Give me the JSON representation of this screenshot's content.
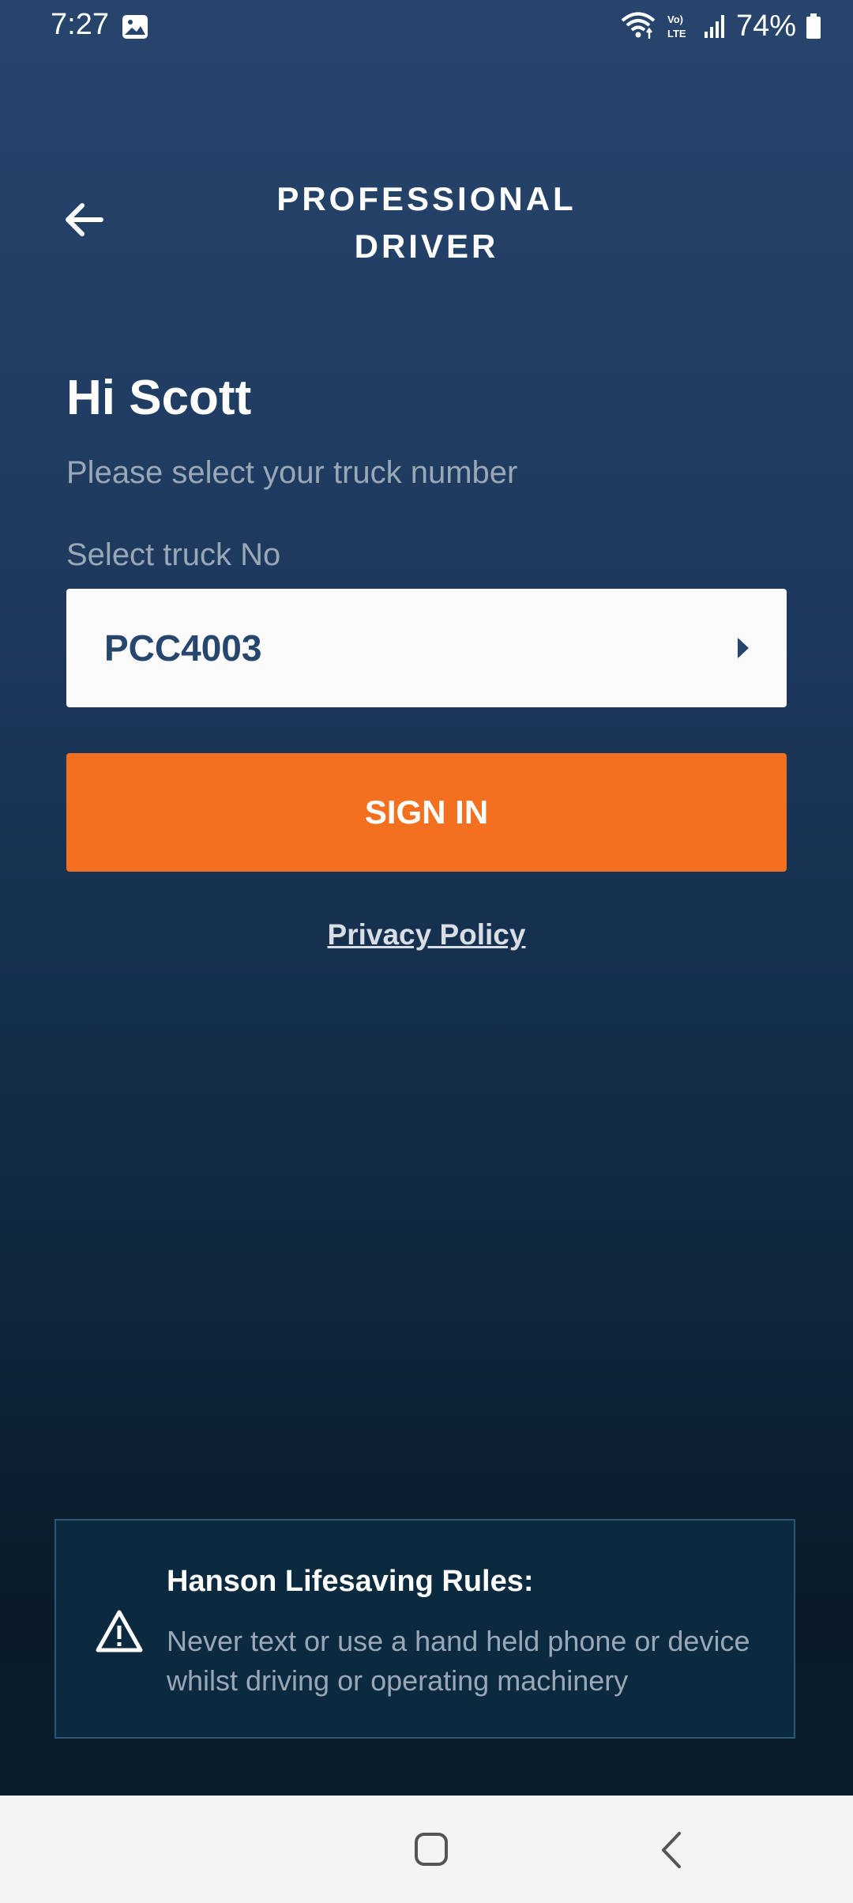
{
  "status_bar": {
    "time": "7:27",
    "battery_percent": "74%",
    "icons": [
      "gallery-icon",
      "wifi-icon",
      "volte-icon",
      "signal-icon",
      "battery-icon"
    ]
  },
  "header": {
    "title_line1": "PROFESSIONAL",
    "title_line2": "DRIVER",
    "back_icon": "arrow-left-icon"
  },
  "main": {
    "greeting": "Hi Scott",
    "subtitle": "Please select your truck number",
    "select_label": "Select truck No",
    "selected_truck": "PCC4003",
    "sign_in_label": "SIGN IN",
    "privacy_label": "Privacy Policy"
  },
  "rules": {
    "title": "Hanson Lifesaving Rules:",
    "text": "Never text or use a hand held phone or device whilst driving or operating machinery",
    "icon": "warning-icon"
  },
  "colors": {
    "accent": "#f37021",
    "background_top": "#27456d",
    "background_bottom": "#0a1a29",
    "select_text": "#26466e"
  }
}
